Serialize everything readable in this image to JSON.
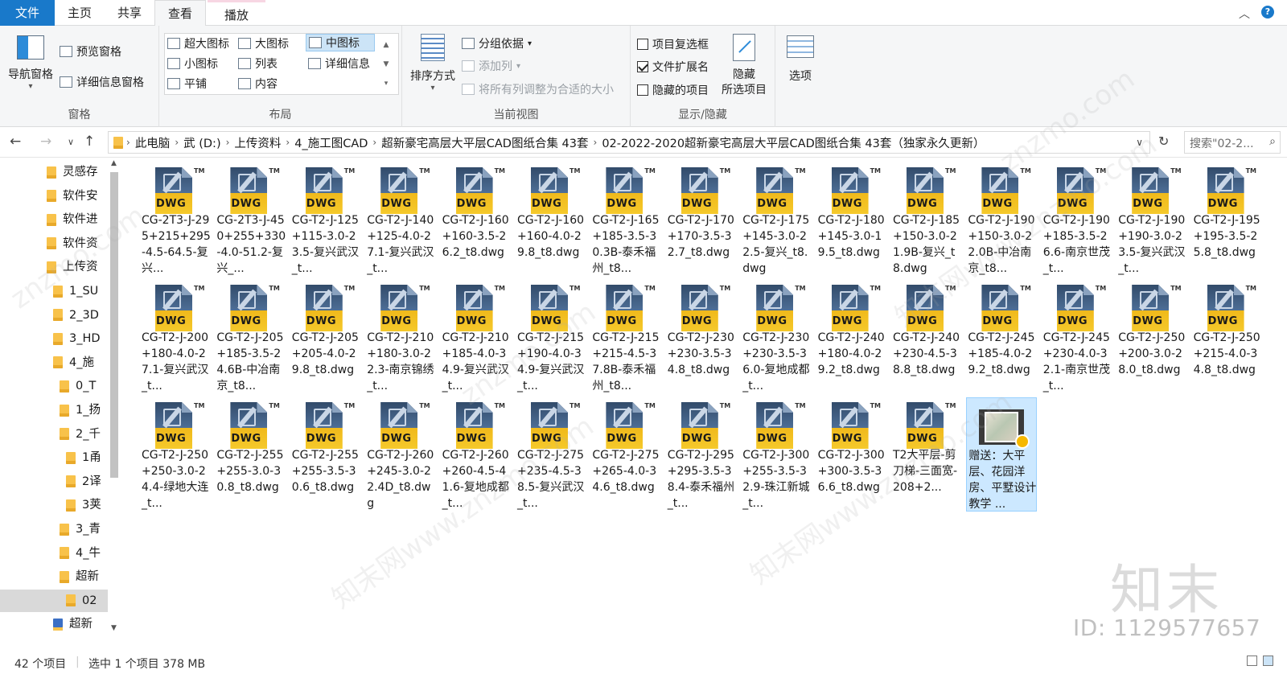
{
  "tabs": {
    "file": "文件",
    "home": "主页",
    "share": "共享",
    "view": "查看",
    "play": "播放"
  },
  "ribbon": {
    "panes": {
      "label": "窗格",
      "nav_pane": "导航窗格",
      "preview_pane": "预览窗格",
      "details_pane": "详细信息窗格"
    },
    "layout": {
      "label": "布局",
      "extra_large": "超大图标",
      "large": "大图标",
      "medium": "中图标",
      "small": "小图标",
      "list": "列表",
      "details": "详细信息",
      "tiles": "平铺",
      "content": "内容",
      "selected": "中图标"
    },
    "current_view": {
      "label": "当前视图",
      "sort": "排序方式",
      "group_by": "分组依据",
      "add_column": "添加列",
      "fit_columns": "将所有列调整为合适的大小"
    },
    "show_hide": {
      "label": "显示/隐藏",
      "item_checkboxes": "项目复选框",
      "item_checkboxes_checked": false,
      "file_extensions": "文件扩展名",
      "file_extensions_checked": true,
      "hidden_items": "隐藏的项目",
      "hidden_items_checked": false,
      "hide_selected_line1": "隐藏",
      "hide_selected_line2": "所选项目"
    },
    "options": "选项"
  },
  "address": {
    "segments": [
      "此电脑",
      "武 (D:)",
      "上传资料",
      "4_施工图CAD",
      "超新豪宅高层大平层CAD图纸合集 43套",
      "02-2022-2020超新豪宅高层大平层CAD图纸合集 43套（独家永久更新）"
    ],
    "search_placeholder": "搜索\"02-2..."
  },
  "nav_tree": [
    {
      "label": "灵感存",
      "indent": 0
    },
    {
      "label": "软件安",
      "indent": 0
    },
    {
      "label": "软件进",
      "indent": 0
    },
    {
      "label": "软件资",
      "indent": 0
    },
    {
      "label": "上传资",
      "indent": 0
    },
    {
      "label": "1_SU",
      "indent": 1
    },
    {
      "label": "2_3D",
      "indent": 1
    },
    {
      "label": "3_HD",
      "indent": 1
    },
    {
      "label": "4_施",
      "indent": 1
    },
    {
      "label": "0_T",
      "indent": 2
    },
    {
      "label": "1_扬",
      "indent": 2
    },
    {
      "label": "2_千",
      "indent": 2
    },
    {
      "label": "1甬",
      "indent": 3
    },
    {
      "label": "2译",
      "indent": 3
    },
    {
      "label": "3荚",
      "indent": 3
    },
    {
      "label": "3_青",
      "indent": 2
    },
    {
      "label": "4_牛",
      "indent": 2
    },
    {
      "label": "超新",
      "indent": 2
    },
    {
      "label": "02",
      "indent": 3,
      "selected": true
    },
    {
      "label": "超新",
      "indent": 1,
      "special": true
    }
  ],
  "files": [
    {
      "name": "CG-2T3-J-295+215+295-4.5-64.5-复兴..."
    },
    {
      "name": "CG-2T3-J-450+255+330-4.0-51.2-复兴_..."
    },
    {
      "name": "CG-T2-J-125+115-3.0-23.5-复兴武汉_t..."
    },
    {
      "name": "CG-T2-J-140+125-4.0-27.1-复兴武汉_t..."
    },
    {
      "name": "CG-T2-J-160+160-3.5-26.2_t8.dwg"
    },
    {
      "name": "CG-T2-J-160+160-4.0-29.8_t8.dwg"
    },
    {
      "name": "CG-T2-J-165+185-3.5-30.3B-泰禾福州_t8..."
    },
    {
      "name": "CG-T2-J-170+170-3.5-32.7_t8.dwg"
    },
    {
      "name": "CG-T2-J-175+145-3.0-22.5-复兴_t8.dwg"
    },
    {
      "name": "CG-T2-J-180+145-3.0-19.5_t8.dwg"
    },
    {
      "name": "CG-T2-J-185+150-3.0-21.9B-复兴_t8.dwg"
    },
    {
      "name": "CG-T2-J-190+150-3.0-22.0B-中冶南京_t8..."
    },
    {
      "name": "CG-T2-J-190+185-3.5-26.6-南京世茂_t..."
    },
    {
      "name": "CG-T2-J-190+190-3.0-23.5-复兴武汉_t..."
    },
    {
      "name": "CG-T2-J-195+195-3.5-25.8_t8.dwg"
    },
    {
      "name": "CG-T2-J-200+180-4.0-27.1-复兴武汉_t..."
    },
    {
      "name": "CG-T2-J-205+185-3.5-24.6B-中冶南京_t8..."
    },
    {
      "name": "CG-T2-J-205+205-4.0-29.8_t8.dwg"
    },
    {
      "name": "CG-T2-J-210+180-3.0-22.3-南京锦绣_t..."
    },
    {
      "name": "CG-T2-J-210+185-4.0-34.9-复兴武汉_t..."
    },
    {
      "name": "CG-T2-J-215+190-4.0-34.9-复兴武汉_t..."
    },
    {
      "name": "CG-T2-J-215+215-4.5-37.8B-泰禾福州_t8..."
    },
    {
      "name": "CG-T2-J-230+230-3.5-34.8_t8.dwg"
    },
    {
      "name": "CG-T2-J-230+230-3.5-36.0-复地成都_t..."
    },
    {
      "name": "CG-T2-J-240+180-4.0-29.2_t8.dwg"
    },
    {
      "name": "CG-T2-J-240+230-4.5-38.8_t8.dwg"
    },
    {
      "name": "CG-T2-J-245+185-4.0-29.2_t8.dwg"
    },
    {
      "name": "CG-T2-J-245+230-4.0-32.1-南京世茂_t..."
    },
    {
      "name": "CG-T2-J-250+200-3.0-28.0_t8.dwg"
    },
    {
      "name": "CG-T2-J-250+215-4.0-34.8_t8.dwg"
    },
    {
      "name": "CG-T2-J-250+250-3.0-24.4-绿地大连_t..."
    },
    {
      "name": "CG-T2-J-255+255-3.0-30.8_t8.dwg"
    },
    {
      "name": "CG-T2-J-255+255-3.5-30.6_t8.dwg"
    },
    {
      "name": "CG-T2-J-260+245-3.0-22.4D_t8.dwg"
    },
    {
      "name": "CG-T2-J-260+260-4.5-41.6-复地成都_t..."
    },
    {
      "name": "CG-T2-J-275+235-4.5-38.5-复兴武汉_t..."
    },
    {
      "name": "CG-T2-J-275+265-4.0-34.6_t8.dwg"
    },
    {
      "name": "CG-T2-J-295+295-3.5-38.4-泰禾福州_t..."
    },
    {
      "name": "CG-T2-J-300+255-3.5-32.9-珠江新城_t..."
    },
    {
      "name": "CG-T2-J-300+300-3.5-36.6_t8.dwg"
    },
    {
      "name": "T2大平层-剪刀梯-三面宽-208+2..."
    },
    {
      "name": "赠送：大平层、花园洋房、平墅设计教学 ...",
      "video": true,
      "selected": true
    }
  ],
  "icon_label": "DWG",
  "icon_tm": "TM",
  "status": {
    "count": "42 个项目",
    "selection": "选中 1 个项目  378 MB"
  },
  "watermark": {
    "brand": "知末",
    "id": "ID: 1129577657",
    "site": "znzmo.com",
    "site_cn": "知末网www.znzmo.com"
  },
  "colors": {
    "accent": "#1979ca",
    "selection": "#cce8ff",
    "folder": "#f8c24a"
  }
}
